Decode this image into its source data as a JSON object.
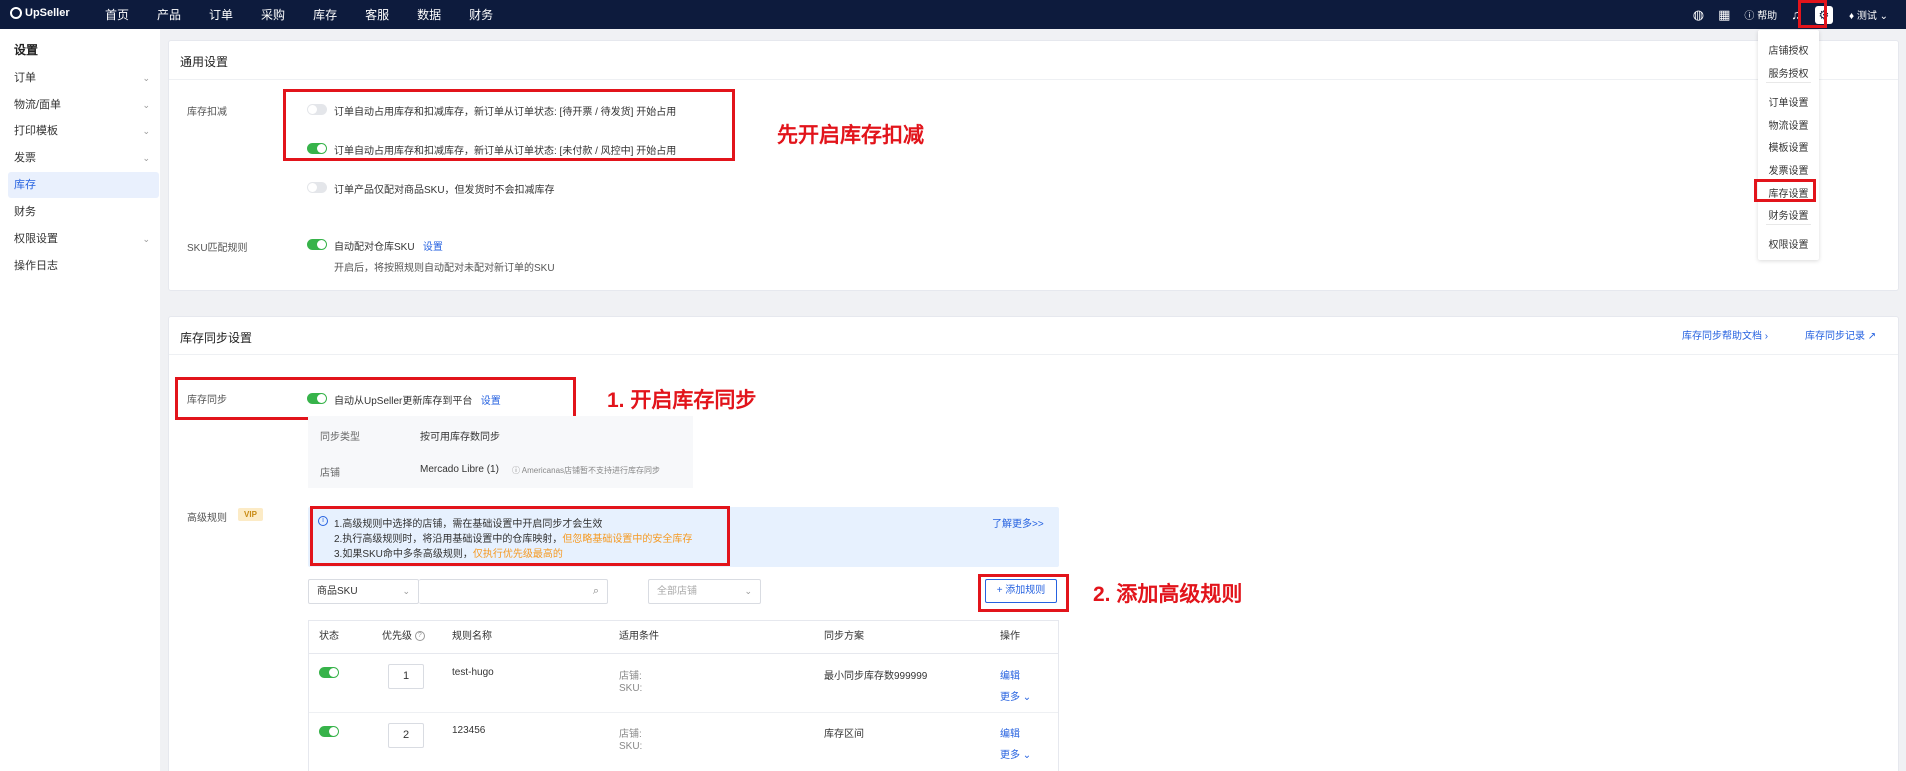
{
  "app": {
    "logo": "UpSeller"
  },
  "nav": [
    "首页",
    "产品",
    "订单",
    "采购",
    "库存",
    "客服",
    "数据",
    "财务"
  ],
  "topbar_right": {
    "help": "帮助",
    "user": "测试"
  },
  "sidebar": {
    "title": "设置",
    "items": [
      {
        "label": "订单",
        "expandable": true
      },
      {
        "label": "物流/面单",
        "expandable": true
      },
      {
        "label": "打印模板",
        "expandable": true
      },
      {
        "label": "发票",
        "expandable": true
      },
      {
        "label": "库存",
        "active": true
      },
      {
        "label": "财务"
      },
      {
        "label": "权限设置",
        "expandable": true
      },
      {
        "label": "操作日志"
      }
    ]
  },
  "settings_menu": {
    "items": [
      "店铺授权",
      "服务授权",
      "订单设置",
      "物流设置",
      "模板设置",
      "发票设置",
      "库存设置",
      "财务设置",
      "权限设置"
    ],
    "active": "库存设置"
  },
  "general": {
    "title": "通用设置",
    "stock_deduct": {
      "label": "库存扣减",
      "options": [
        {
          "text": "订单自动占用库存和扣减库存，新订单从订单状态: [待开票 / 待发货] 开始占用",
          "on": false
        },
        {
          "text": "订单自动占用库存和扣减库存，新订单从订单状态: [未付款 / 风控中] 开始占用",
          "on": true
        },
        {
          "text": "订单产品仅配对商品SKU，但发货时不会扣减库存",
          "on": false
        }
      ]
    },
    "sku_match": {
      "label": "SKU匹配规则",
      "text": "自动配对仓库SKU",
      "link": "设置",
      "on": true,
      "desc": "开启后，将按照规则自动配对未配对新订单的SKU"
    }
  },
  "sync": {
    "title": "库存同步设置",
    "help_link": "库存同步帮助文档",
    "record_link": "库存同步记录",
    "label": "库存同步",
    "text": "自动从UpSeller更新库存到平台",
    "link": "设置",
    "on": true,
    "type_label": "同步类型",
    "type_value": "按可用库存数同步",
    "store_label": "店铺",
    "store_value": "Mercado Libre (1)",
    "store_note": "Americanas店铺暂不支持进行库存同步"
  },
  "advanced": {
    "label": "高级规则",
    "vip": "VIP",
    "info": {
      "line1": "1.高级规则中选择的店铺，需在基础设置中开启同步才会生效",
      "line2_a": "2.执行高级规则时，将沿用基础设置中的仓库映射，",
      "line2_b": "但忽略基础设置中的安全库存",
      "line3_a": "3.如果SKU命中多条高级规则，",
      "line3_b": "仅执行优先级最高的",
      "more": "了解更多>>"
    },
    "filter": {
      "sku_select": "商品SKU",
      "search_placeholder": "",
      "store_select": "全部店铺"
    },
    "add_button": "+ 添加规则",
    "table": {
      "headers": [
        "状态",
        "优先级",
        "规则名称",
        "适用条件",
        "同步方案",
        "操作"
      ],
      "rows": [
        {
          "on": true,
          "priority": "1",
          "name": "test-hugo",
          "cond_store": "店铺:",
          "cond_sku": "SKU:",
          "plan": "最小同步库存数999999",
          "edit": "编辑",
          "more": "更多"
        },
        {
          "on": true,
          "priority": "2",
          "name": "123456",
          "cond_store": "店铺:",
          "cond_sku": "SKU:",
          "plan": "库存区间",
          "edit": "编辑",
          "more": "更多"
        }
      ]
    }
  },
  "annotations": {
    "a1": "先开启库存扣减",
    "a2": "1. 开启库存同步",
    "a3": "2. 添加高级规则"
  },
  "colors": {
    "topbar": "#0d1b3d",
    "accent": "#2662e0",
    "toggle_on": "#37b34a",
    "annotation": "#e2141b",
    "warning": "#f59a23"
  }
}
